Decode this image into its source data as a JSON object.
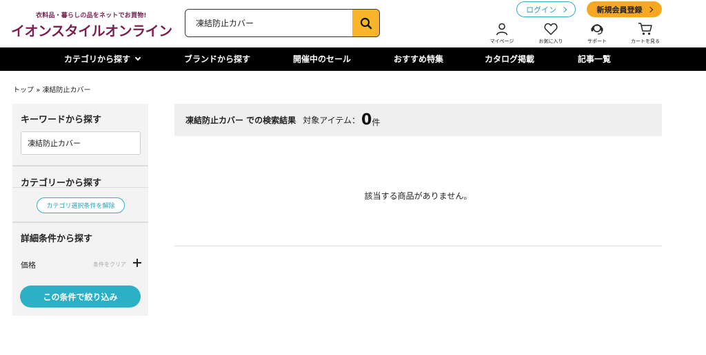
{
  "header": {
    "logo_tagline": "衣料品・暮らしの品をネットでお買物!",
    "logo_name": "イオンスタイルオンライン",
    "search_value": "凍結防止カバー",
    "login_label": "ログイン",
    "register_label": "新規会員登録",
    "icons": [
      {
        "name": "mypage",
        "label": "マイページ"
      },
      {
        "name": "favorites",
        "label": "お気に入り"
      },
      {
        "name": "support",
        "label": "サポート"
      },
      {
        "name": "cart",
        "label": "カートを見る"
      }
    ]
  },
  "nav": {
    "items": [
      {
        "label": "カテゴリから探す"
      },
      {
        "label": "ブランドから探す"
      },
      {
        "label": "開催中のセール"
      },
      {
        "label": "おすすめ特集"
      },
      {
        "label": "カタログ掲載"
      },
      {
        "label": "記事一覧"
      }
    ]
  },
  "breadcrumb": {
    "top": "トップ",
    "separator": "»",
    "current": "凍結防止カバー"
  },
  "sidebar": {
    "keyword_heading": "キーワードから探す",
    "keyword_value": "凍結防止カバー",
    "category_heading": "カテゴリーから探す",
    "clear_category_label": "カテゴリ選択条件を解除",
    "detail_heading": "詳細条件から探す",
    "price_label": "価格",
    "price_clear_label": "条件をクリア",
    "apply_label": "この条件で絞り込み"
  },
  "results": {
    "keyword_text": "凍結防止カバー での検索結果",
    "count_label": "対象アイテム：",
    "count": "0",
    "count_unit": "件",
    "empty_message": "該当する商品がありません。"
  },
  "colors": {
    "brand": "#7a1f52",
    "accent_orange": "#f7a823",
    "accent_teal": "#2bb0c5",
    "nav_bg": "#000000"
  }
}
